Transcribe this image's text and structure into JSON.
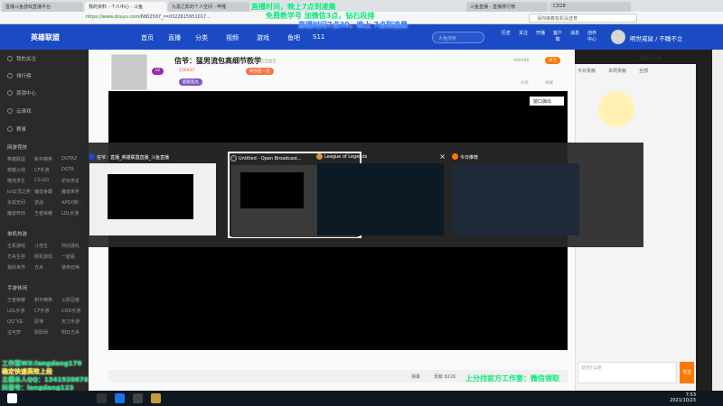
{
  "browser": {
    "tabs": [
      "直播斗鱼游戏直播平台",
      "我的资料 - 个人中心 - 斗鱼",
      "九嘉之影的个人空间 - 哔哩",
      "斗鱼直播 - 直播排行榜",
      "CD28"
    ],
    "url_domain": "https://www.douyu.com",
    "url_path": "/6802507_r=0322615951017...",
    "search_placeholder": "请你接着有机没选育"
  },
  "overlay": {
    "top_green": "直播时间，晚上7点到凌晨",
    "top_green2": "免费教学号 加微信3点，钻石段排",
    "top_blue": "直播时间7点30，晚上 7点到凌晨",
    "bl_line1": "工作室WX:langdang179",
    "bl_line2": "确定快速高效上段",
    "bl_line3": "主播本人QQ：1341920676",
    "bl_line4": "抖音号：langdang123",
    "bottom_center": "上分找官方工作室：微信领取"
  },
  "header": {
    "logo": "英雄联盟",
    "nav": [
      "首页",
      "直播",
      "分类",
      "视频",
      "游戏",
      "鱼吧",
      "S11"
    ],
    "search_placeholder": "大鱼搜索",
    "icons": [
      "历史",
      "关注",
      "开播",
      "客户端",
      "消息",
      "创作中心"
    ],
    "username": "明世戒鼠 / 不睡不立"
  },
  "sidebar": {
    "items": [
      "我的关注",
      "排行榜",
      "资源中心",
      "云游戏",
      "赛事"
    ],
    "section1": "网游竞技",
    "section1_grid": [
      "英雄联盟",
      "和平精英",
      "DOTA2",
      "穿越火线",
      "CF手游",
      "DOTA",
      "绝地求生",
      "CS:GO",
      "炉石传说",
      "lol云顶之弈",
      "魔兽争霸",
      "魔兽世界",
      "永劫无间",
      "逆战",
      "APEX英雄",
      "魔兽怀旧",
      "王者荣耀",
      "LOL手游"
    ],
    "section2": "单机热游",
    "section2_grid": [
      "主机游戏",
      "斗地主",
      "怀旧游戏",
      "方舟生存",
      "街机游戏",
      "一起看",
      "我的世界",
      "方舟",
      "使命召唤"
    ],
    "section3": "手游休闲",
    "section3_grid": [
      "王者荣耀",
      "和平精英",
      "火影忍者",
      "LOL手游",
      "CF手游",
      "COD手游",
      "QQ飞车",
      "原神",
      "天刀手游",
      "宝可梦",
      "阴阳师",
      "明日方舟"
    ]
  },
  "room": {
    "title": "信爷：猛男流包高细节教学",
    "category": "英雄联盟 > 吉吉国王",
    "level_badge": "LV",
    "fans": "156637",
    "tag1": "峡谷超一流",
    "tag2": "超级鱼丸",
    "follow_count": "466698",
    "follow_btn": "关注",
    "share": "分享",
    "report": "举报",
    "window_pop": "窗口弹出",
    "mute": "弹幕",
    "viewers": "贡献 8226"
  },
  "right": {
    "tabs": [
      "今日贡献",
      "本周贡献",
      "全部"
    ],
    "chat_placeholder": "说点什么吧",
    "send": "发送",
    "header_label": "直播间贡献"
  },
  "switcher": {
    "windows": [
      {
        "title": "信爷：直播_英雄联盟直播_斗鱼直播"
      },
      {
        "title": "Untitled - Open Broadcast..."
      },
      {
        "title": "League of Legends"
      },
      {
        "title": "今日推荐"
      }
    ]
  },
  "taskbar": {
    "time": "7:53",
    "date": "2021/10/23"
  },
  "colors": {
    "brand": "#1b4bc4",
    "overlay_green": "#00e676",
    "overlay_blue": "#2979ff",
    "orange": "#ff7700"
  }
}
